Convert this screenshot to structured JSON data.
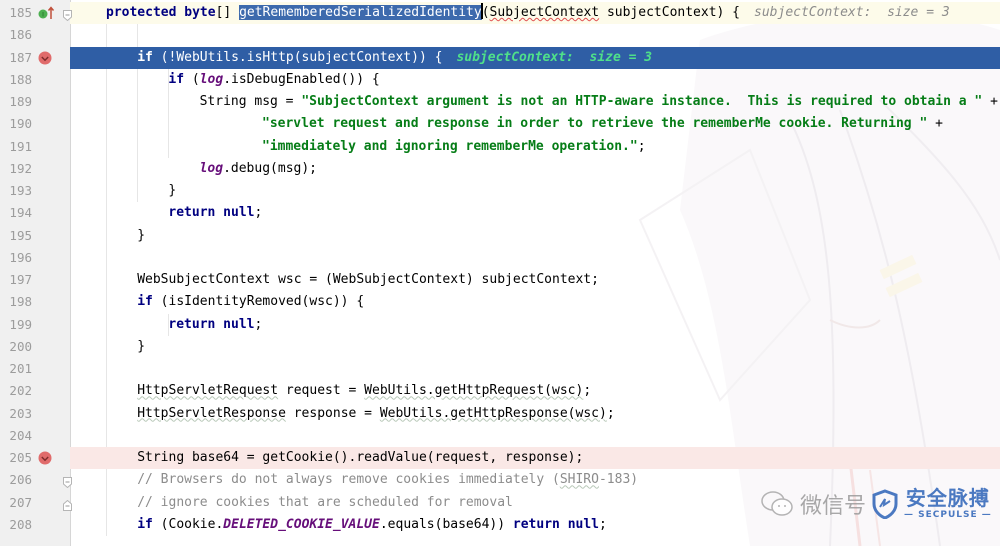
{
  "editor": {
    "colors": {
      "execution_line": "#2f5ea5",
      "breakpoint_line": "#fae8e6",
      "current_line": "#fdfbea",
      "keyword": "#000080",
      "string": "#067d17",
      "static_field": "#660e7a",
      "comment": "#8c8c8c",
      "inline_hint_on_exec": "#4fe08a"
    },
    "lines": [
      {
        "number": "185",
        "gutter_icon": "overrides-method-icon",
        "fold": "fold-open",
        "tokens": {
          "kw1": "protected ",
          "kw2": "byte",
          "p1": "[] ",
          "method": "getRememberedSerializedIdentity",
          "p2": "(",
          "type": "SubjectContext",
          "p3": " subjectContext) {",
          "hint": "subjectContext:  size = 3"
        }
      },
      {
        "number": "186",
        "tokens": {}
      },
      {
        "number": "187",
        "gutter_icon": "breakpoint-verified-icon",
        "tokens": {
          "kw": "if",
          "rest": " (!WebUtils.isHttp(subjectContext)) {",
          "hint": "subjectContext:  size = 3"
        }
      },
      {
        "number": "188",
        "tokens": {
          "kw": "if",
          "p1": " (",
          "field": "log",
          "p2": ".isDebugEnabled()) {"
        }
      },
      {
        "number": "189",
        "tokens": {
          "p1": "String msg = ",
          "str": "\"SubjectContext argument is not an HTTP-aware instance.  This is required to obtain a \"",
          "p2": " +"
        }
      },
      {
        "number": "190",
        "tokens": {
          "str": "\"servlet request and response in order to retrieve the rememberMe cookie. Returning \"",
          "p2": " +"
        }
      },
      {
        "number": "191",
        "tokens": {
          "str": "\"immediately and ignoring rememberMe operation.\"",
          "p2": ";"
        }
      },
      {
        "number": "192",
        "tokens": {
          "field": "log",
          "p2": ".debug(msg);"
        }
      },
      {
        "number": "193",
        "tokens": {
          "p1": "}"
        }
      },
      {
        "number": "194",
        "tokens": {
          "kw": "return null",
          "p1": ";"
        }
      },
      {
        "number": "195",
        "tokens": {
          "p1": "}"
        }
      },
      {
        "number": "196",
        "tokens": {}
      },
      {
        "number": "197",
        "tokens": {
          "p1": "WebSubjectContext wsc = (WebSubjectContext) subjectContext;"
        }
      },
      {
        "number": "198",
        "tokens": {
          "kw": "if",
          "p1": " (isIdentityRemoved(wsc)) {"
        }
      },
      {
        "number": "199",
        "tokens": {
          "kw": "return null",
          "p1": ";"
        }
      },
      {
        "number": "200",
        "tokens": {
          "p1": "}"
        }
      },
      {
        "number": "201",
        "tokens": {}
      },
      {
        "number": "202",
        "tokens": {
          "t1": "HttpServletRequest",
          "p1": " request = ",
          "t2": "WebUtils.getHttpRequest(wsc)",
          "p2": ";"
        }
      },
      {
        "number": "203",
        "tokens": {
          "t1": "HttpServletResponse",
          "p1": " response = ",
          "t2": "WebUtils.getHttpResponse(wsc)",
          "p2": ";"
        }
      },
      {
        "number": "204",
        "tokens": {}
      },
      {
        "number": "205",
        "gutter_icon": "breakpoint-verified-icon",
        "tokens": {
          "p1": "String base64 = getCookie().readValue(request, response);"
        }
      },
      {
        "number": "206",
        "fold": "fold-open",
        "tokens": {
          "c1": "// Browsers do not always remove cookies immediately (",
          "c2": "SHIRO",
          "c3": "-183)"
        }
      },
      {
        "number": "207",
        "fold": "fold-close",
        "tokens": {
          "c1": "// ignore cookies that are scheduled for removal"
        }
      },
      {
        "number": "208",
        "tokens": {
          "kw": "if",
          "p1": " (Cookie.",
          "field": "DELETED_COOKIE_VALUE",
          "p2": ".equals(base64)) ",
          "kw2": "return null",
          "p3": ";"
        }
      }
    ]
  },
  "watermark": {
    "wechat_text": "微信号",
    "brand_cn": "安全脉搏",
    "brand_en": "— SECPULSE —"
  }
}
